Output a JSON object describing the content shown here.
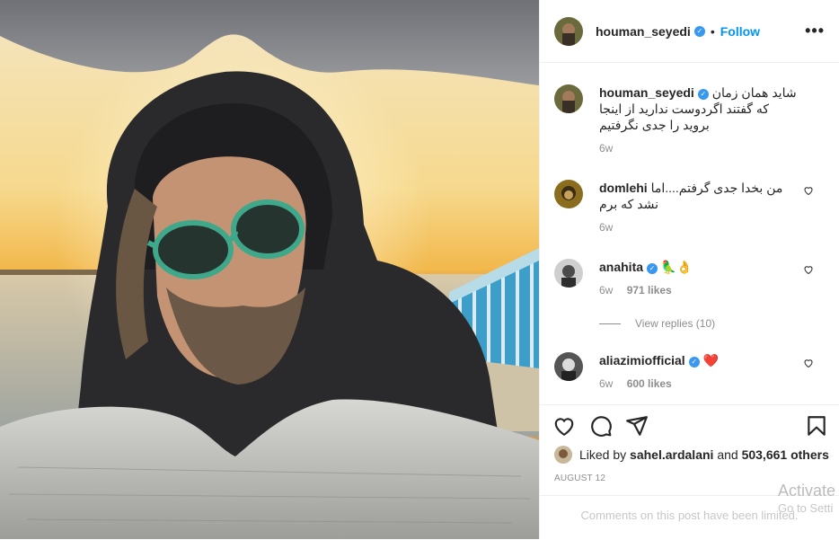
{
  "post": {
    "photo_alt": "",
    "author": {
      "username": "houman_seyedi",
      "verified": true,
      "follow_label": "Follow",
      "separator": "•",
      "more_label": "•••"
    },
    "caption": {
      "username": "houman_seyedi",
      "text": "شاید همان زمان که گفتند اگردوست ندارید از اینجا بروید را جدی نگرفتیم",
      "age": "6w"
    },
    "comments": [
      {
        "username": "domlehi",
        "verified": false,
        "text": "من بخدا جدی گرفتم....اما نشد که برم",
        "age": "6w",
        "likes": ""
      },
      {
        "username": "anahita",
        "verified": true,
        "text": "🦜👌",
        "age": "6w",
        "likes": "971 likes",
        "view_replies": "View replies (10)"
      },
      {
        "username": "aliazimiofficial",
        "verified": true,
        "text": "❤️",
        "age": "6w",
        "likes": "600 likes"
      }
    ],
    "liked_by_prefix": "Liked by",
    "liked_by_user": "sahel.ardalani",
    "liked_by_and": "and",
    "liked_by_others": "503,661 others",
    "date": "AUGUST 12",
    "comments_disabled": "Comments on this post have been limited.",
    "watermark_line1": "Activate",
    "watermark_line2": "Go to Setti",
    "colors": {
      "accent": "#0095f6",
      "verified": "#3897f0",
      "like_red": "#ed4956",
      "muted": "#8e8e8e"
    }
  }
}
